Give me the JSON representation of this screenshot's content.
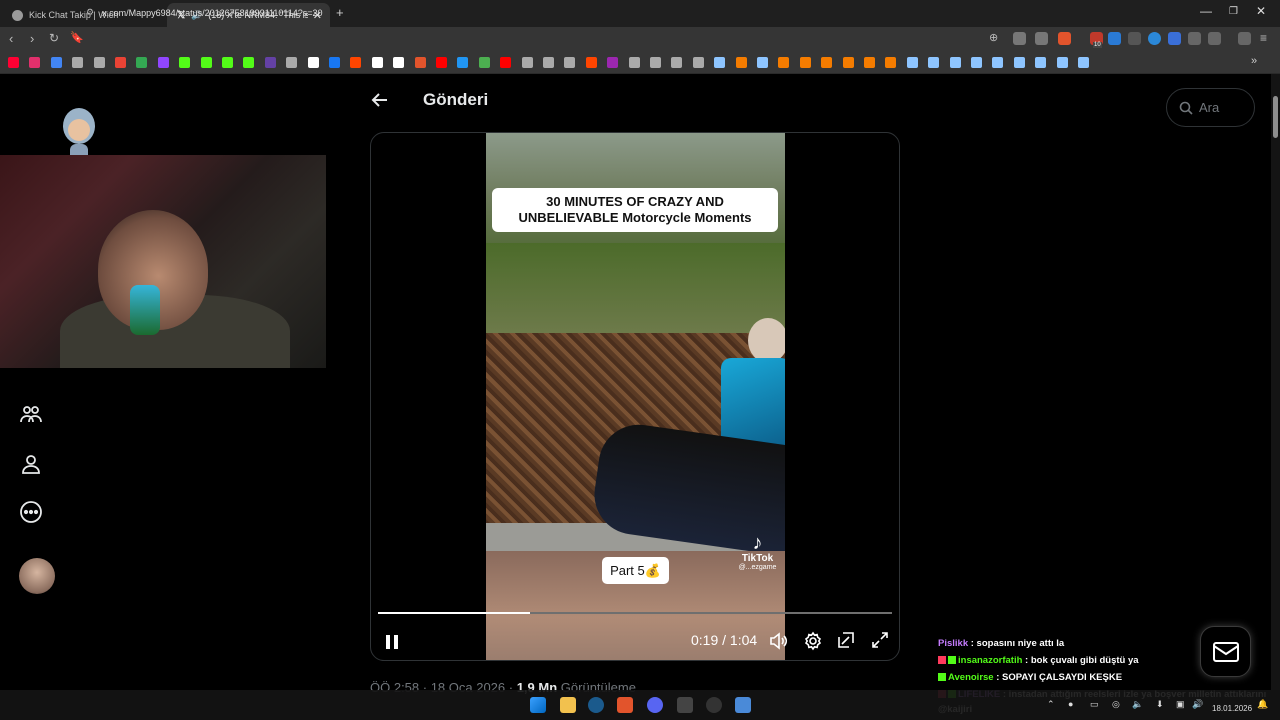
{
  "browser": {
    "tabs": [
      {
        "label": "Kick Chat Takip | Wich",
        "active": false
      },
      {
        "label": "(18) X'te NRM84: \"This is so s",
        "active": true
      }
    ],
    "new_tab": "+",
    "url": "x.com/Mappy6984/status/2012675819991110114?s=20",
    "window_controls": [
      "minimize",
      "maximize",
      "close"
    ],
    "extension_badge": "10"
  },
  "x": {
    "page_title": "Gönderi",
    "search_placeholder": "Ara",
    "video": {
      "caption_line1": "30 MINUTES OF CRAZY AND",
      "caption_line2": "UNBELIEVABLE Motorcycle Moments",
      "part_label": "Part 5",
      "part_emoji": "💰",
      "watermark_brand": "TikTok",
      "watermark_handle": "@...ezgame",
      "current_time": "0:19",
      "duration": "1:04",
      "time_separator": " / ",
      "progress_fraction": 0.295
    },
    "post_meta": {
      "time_date": "ÖÖ 2:58 · 18 Oca 2026 ·",
      "views_count": "1,9 Mn",
      "views_label": "Görüntüleme"
    }
  },
  "stream_chat": [
    {
      "user": "Pislikk",
      "message": ": sopasını niye attı la",
      "user_color": "#c67cff",
      "badges": []
    },
    {
      "user": "insanazorfatih",
      "message": ": bok çuvalı gibi düştü ya",
      "user_color": "#53fc18",
      "badges": [
        "kick",
        "sub"
      ]
    },
    {
      "user": "Avenoirse",
      "message": ": SOPAYI ÇALSAYDI KEŞKE",
      "user_color": "#53fc18",
      "badges": [
        "sub"
      ]
    },
    {
      "user": "LIFELIKE",
      "message": ": instadan attığım reelsleri izle ya boşver milletin attıklarını",
      "user_color": "#c67cff",
      "badges": [
        "kick",
        "sub"
      ]
    },
    {
      "user": "",
      "message": "@kaijiri",
      "user_color": "#ffffff",
      "badges": []
    }
  ],
  "taskbar": {
    "date": "18.01.2026"
  },
  "colors": {
    "kick_green": "#53fc18",
    "x_text": "#e7e9ea",
    "x_muted": "#71767b",
    "x_border": "#2f3336"
  }
}
